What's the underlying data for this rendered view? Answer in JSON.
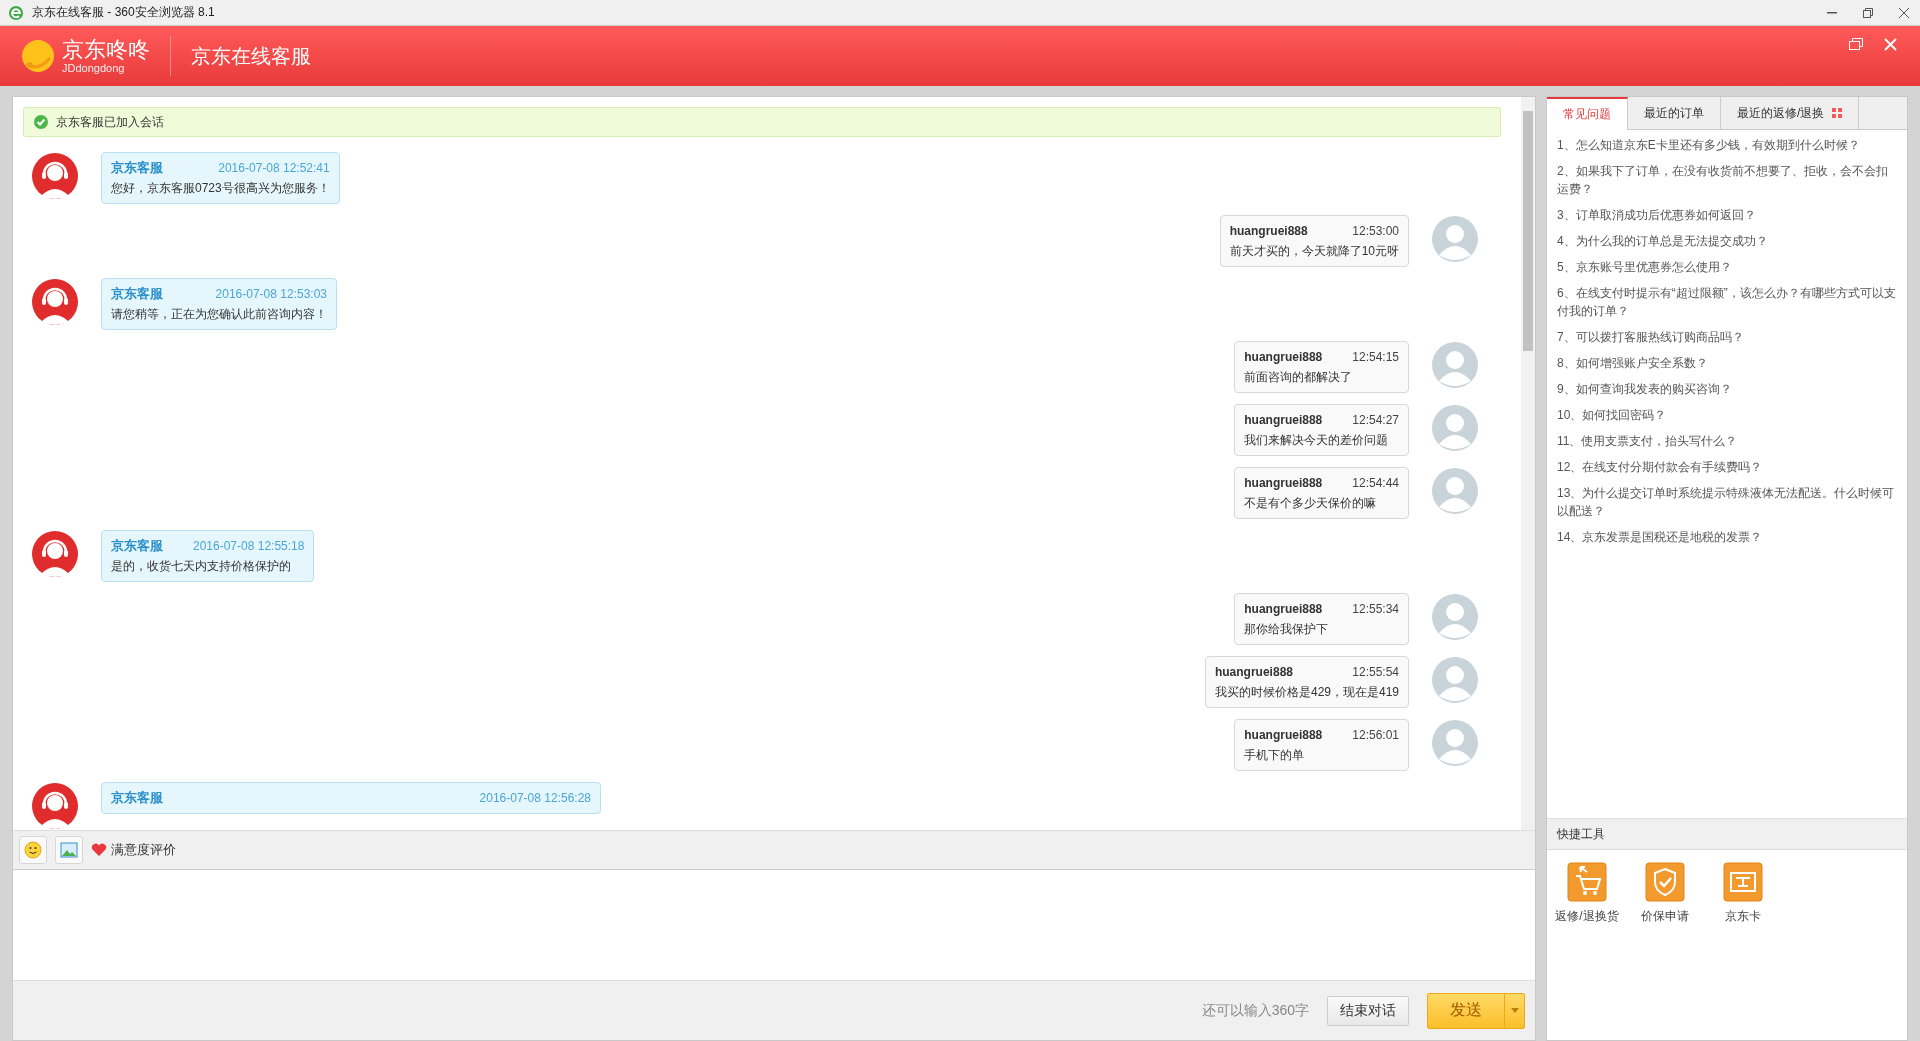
{
  "window": {
    "title": "京东在线客服 - 360安全浏览器 8.1"
  },
  "header": {
    "logo_name": "京东咚咚",
    "logo_sub": "JDdongdong",
    "title": "京东在线客服"
  },
  "chat": {
    "notice": "京东客服已加入会话",
    "messages": [
      {
        "kind": "agent",
        "sender": "京东客服",
        "time": "2016-07-08 12:52:41",
        "text": "您好，京东客服0723号很高兴为您服务！"
      },
      {
        "kind": "user",
        "sender": "huangruei888",
        "time": "12:53:00",
        "text": "前天才买的，今天就降了10元呀"
      },
      {
        "kind": "agent",
        "sender": "京东客服",
        "time": "2016-07-08 12:53:03",
        "text": "请您稍等，正在为您确认此前咨询内容！"
      },
      {
        "kind": "user",
        "sender": "huangruei888",
        "time": "12:54:15",
        "text": "前面咨询的都解决了"
      },
      {
        "kind": "user",
        "sender": "huangruei888",
        "time": "12:54:27",
        "text": "我们来解决今天的差价问题"
      },
      {
        "kind": "user",
        "sender": "huangruei888",
        "time": "12:54:44",
        "text": "不是有个多少天保价的嘛"
      },
      {
        "kind": "agent",
        "sender": "京东客服",
        "time": "2016-07-08 12:55:18",
        "text": "是的，收货七天内支持价格保护的"
      },
      {
        "kind": "user",
        "sender": "huangruei888",
        "time": "12:55:34",
        "text": "那你给我保护下"
      },
      {
        "kind": "user",
        "sender": "huangruei888",
        "time": "12:55:54",
        "text": "我买的时候价格是429，现在是419"
      },
      {
        "kind": "user",
        "sender": "huangruei888",
        "time": "12:56:01",
        "text": "手机下的单"
      },
      {
        "kind": "agent",
        "sender": "京东客服",
        "time": "2016-07-08 12:56:28"
      }
    ],
    "rating": "满意度评价",
    "counter": "还可以输入360字",
    "end_button": "结束对话",
    "send_button": "发送"
  },
  "side": {
    "tabs": [
      {
        "label": "常见问题",
        "selected": true
      },
      {
        "label": "最近的订单",
        "selected": false
      },
      {
        "label": "最近的返修/退换",
        "selected": false
      }
    ],
    "faq": [
      "1、怎么知道京东E卡里还有多少钱，有效期到什么时候？",
      "2、如果我下了订单，在没有收货前不想要了、拒收，会不会扣运费？",
      "3、订单取消成功后优惠券如何返回？",
      "4、为什么我的订单总是无法提交成功？",
      "5、京东账号里优惠券怎么使用？",
      "6、在线支付时提示有“超过限额”，该怎么办？有哪些方式可以支付我的订单？",
      "7、可以拨打客服热线订购商品吗？",
      "8、如何增强账户安全系数？",
      "9、如何查询我发表的购买咨询？",
      "10、如何找回密码？",
      "11、使用支票支付，抬头写什么？",
      "12、在线支付分期付款会有手续费吗？",
      "13、为什么提交订单时系统提示特殊液体无法配送。什么时候可以配送？",
      "14、京东发票是国税还是地税的发票？"
    ],
    "tools_title": "快捷工具",
    "tools": [
      {
        "kind": "cart",
        "label": "返修/退换货"
      },
      {
        "kind": "shield",
        "label": "价保申请"
      },
      {
        "kind": "card",
        "label": "京东卡"
      }
    ]
  }
}
